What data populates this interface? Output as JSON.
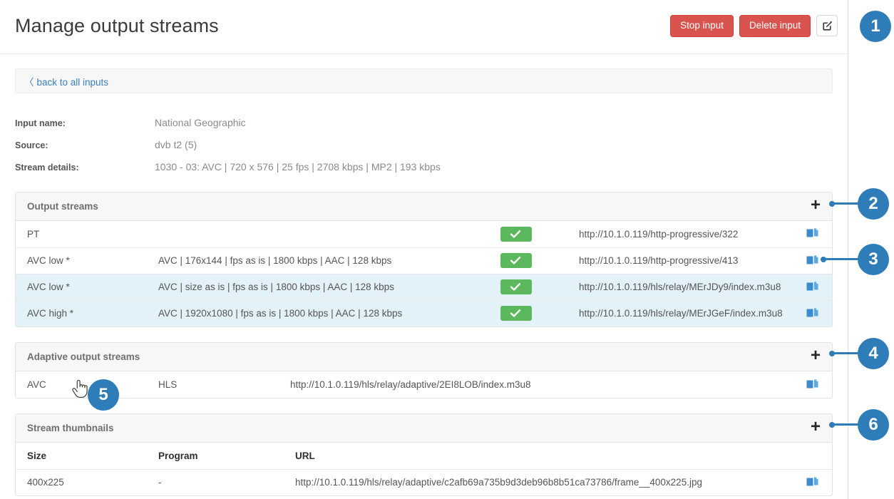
{
  "header": {
    "title": "Manage output streams",
    "stop_label": "Stop input",
    "delete_label": "Delete input",
    "edit_icon": "pencil-square-icon"
  },
  "backbar": {
    "chevron": "〈",
    "label": "back to all inputs"
  },
  "info": [
    {
      "label": "Input name:",
      "value": "National Geographic"
    },
    {
      "label": "Source:",
      "value": "dvb t2 (5)"
    },
    {
      "label": "Stream details:",
      "value": "1030 - 03: AVC | 720 x 576 | 25 fps | 2708 kbps | MP2 | 193 kbps"
    }
  ],
  "output_streams": {
    "title": "Output streams",
    "add_label": "+",
    "rows": [
      {
        "name": "PT",
        "desc": "",
        "enabled": true,
        "url": "http://10.1.0.119/http-progressive/322",
        "copy": "copy-icon"
      },
      {
        "name": "AVC low *",
        "desc": "AVC | 176x144 | fps as is | 1800 kbps | AAC | 128 kbps",
        "enabled": true,
        "url": "http://10.1.0.119/http-progressive/413",
        "copy": "copy-icon"
      },
      {
        "name": "AVC low *",
        "desc": "AVC | size as is | fps as is | 1800 kbps | AAC | 128 kbps",
        "enabled": true,
        "url": "http://10.1.0.119/hls/relay/MErJDy9/index.m3u8",
        "copy": "copy-icon"
      },
      {
        "name": "AVC high *",
        "desc": "AVC | 1920x1080 | fps as is | 1800 kbps | AAC | 128 kbps",
        "enabled": true,
        "url": "http://10.1.0.119/hls/relay/MErJGeF/index.m3u8",
        "copy": "copy-icon"
      }
    ]
  },
  "adaptive_streams": {
    "title": "Adaptive output streams",
    "add_label": "+",
    "rows": [
      {
        "codec": "AVC",
        "protocol": "HLS",
        "url": "http://10.1.0.119/hls/relay/adaptive/2EI8LOB/index.m3u8",
        "copy": "copy-icon"
      }
    ]
  },
  "thumbnails": {
    "title": "Stream thumbnails",
    "add_label": "+",
    "columns": [
      "Size",
      "Program",
      "URL"
    ],
    "rows": [
      {
        "size": "400x225",
        "program": "-",
        "url": "http://10.1.0.119/hls/relay/adaptive/c2afb69a735b9d3deb96b8b51ca73786/frame__400x225.jpg",
        "copy": "copy-icon"
      }
    ]
  },
  "callouts": [
    {
      "number": "1"
    },
    {
      "number": "2"
    },
    {
      "number": "3"
    },
    {
      "number": "4"
    },
    {
      "number": "5"
    },
    {
      "number": "6"
    }
  ],
  "colors": {
    "danger": "#d9534f",
    "success": "#5cb85c",
    "link": "#3a7fc1",
    "callout": "#2e7cb8",
    "copy_icon": "#3b8bd0"
  },
  "cursor": {
    "type": "pointer-hand-cursor"
  }
}
